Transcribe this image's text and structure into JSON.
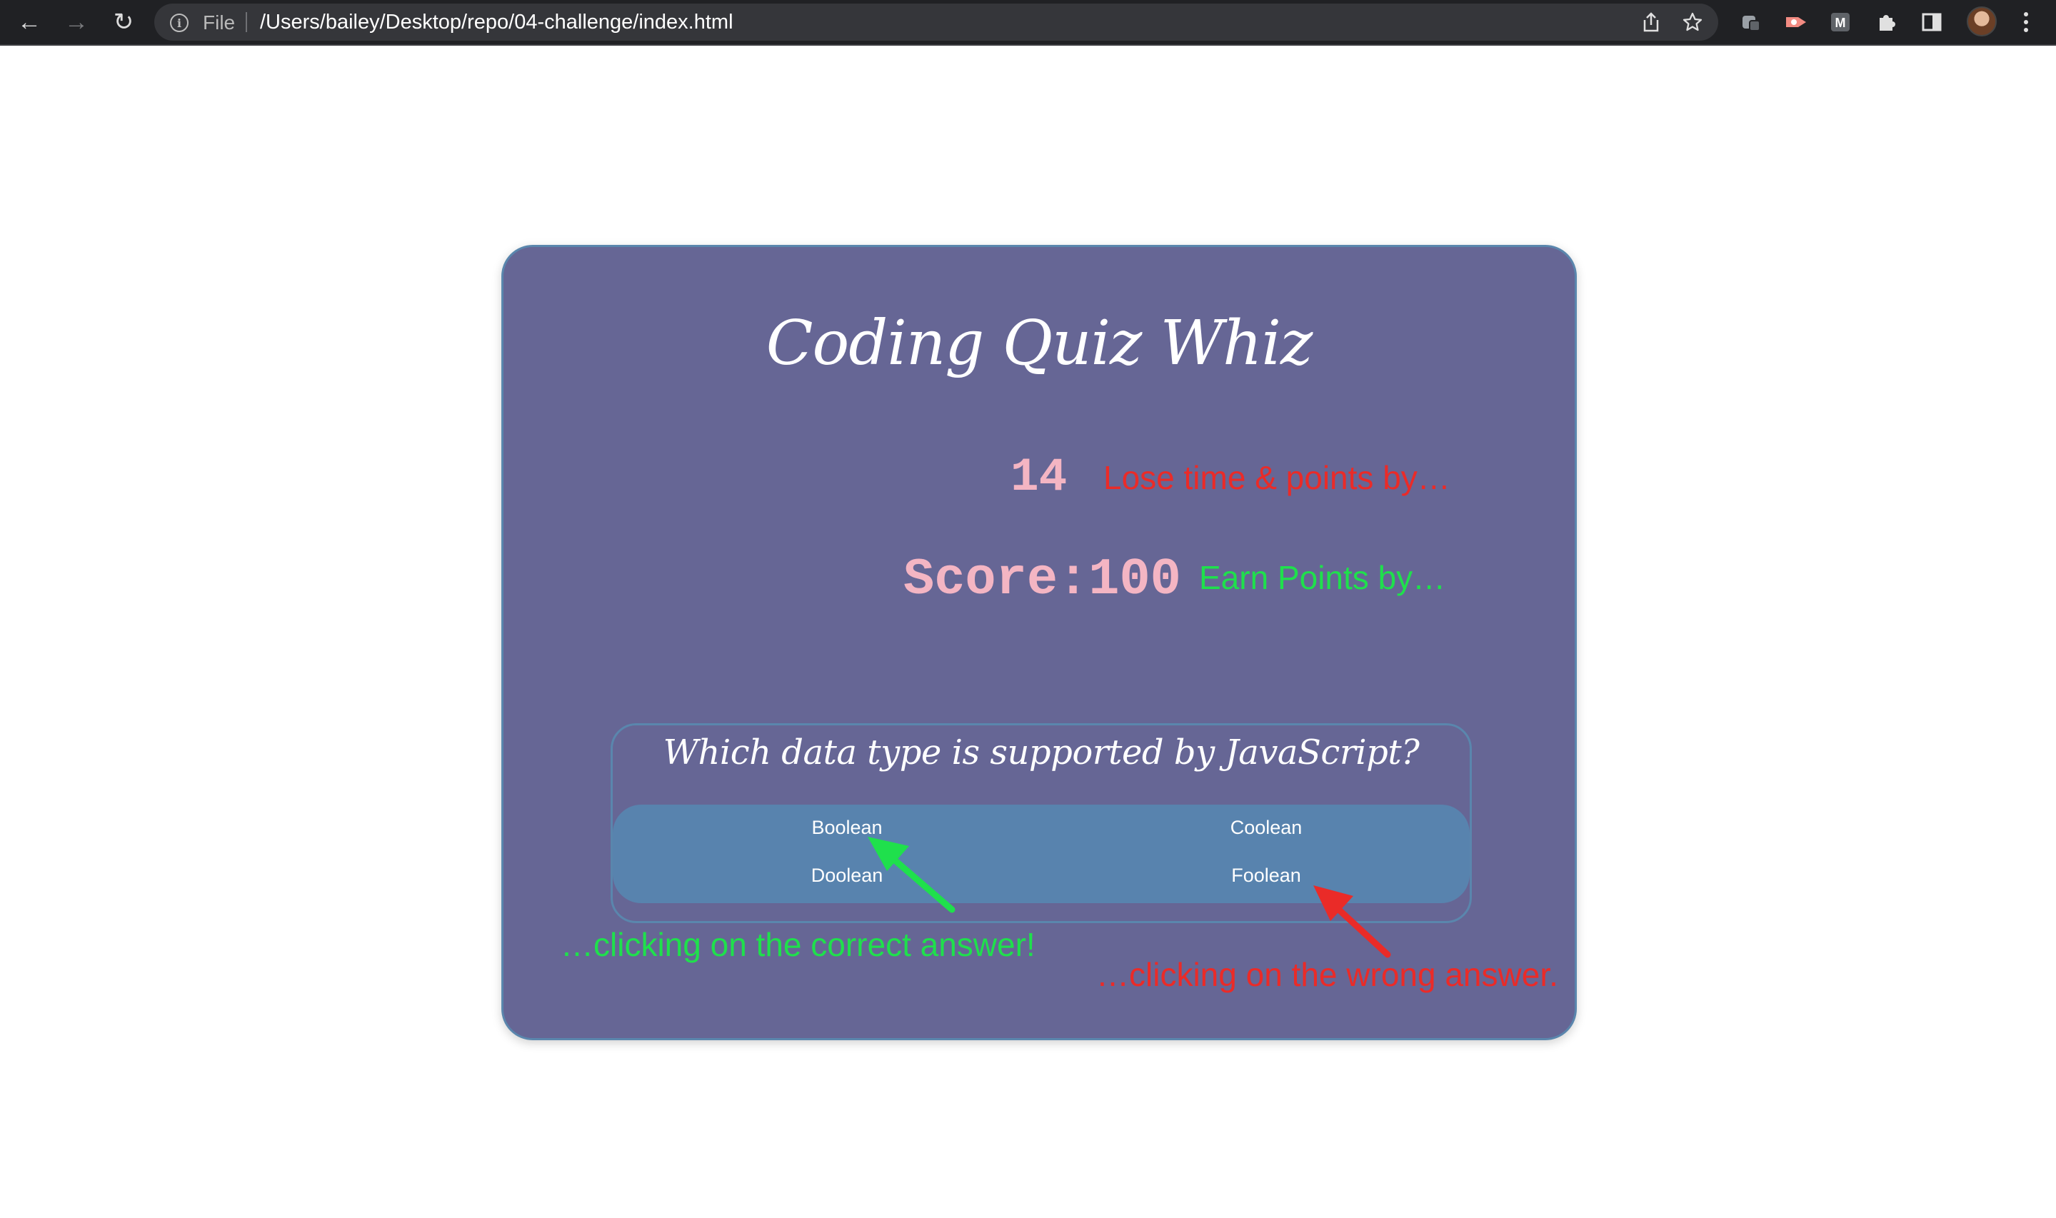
{
  "browser": {
    "file_label": "File",
    "url": "/Users/bailey/Desktop/repo/04-challenge/index.html",
    "icons": {
      "back": "back-arrow-icon",
      "forward": "forward-arrow-icon",
      "reload": "reload-icon",
      "info": "info-icon",
      "share": "share-icon",
      "bookmark": "star-icon",
      "extensions": [
        "extension-icon",
        "extension-icon",
        "extension-icon",
        "puzzle-icon",
        "side-panel-icon"
      ],
      "menu": "more-vert-icon"
    }
  },
  "quiz": {
    "title": "Coding Quiz Whiz",
    "timer": "14",
    "lose_hint": "Lose time & points by…",
    "score": "Score:100",
    "earn_hint": "Earn Points by…",
    "question": "Which data type is supported by JavaScript?",
    "answers": [
      "Boolean",
      "Coolean",
      "Doolean",
      "Foolean"
    ],
    "correct_caption": "…clicking on the correct answer!",
    "wrong_caption": "…clicking on the wrong answer."
  },
  "colors": {
    "card_bg": "#666695",
    "card_border": "#5a86ad",
    "answers_bg": "#5883ae",
    "score_pink": "#f4b5c3",
    "correct_green": "#1fe04c",
    "wrong_red": "#ea2b28"
  }
}
